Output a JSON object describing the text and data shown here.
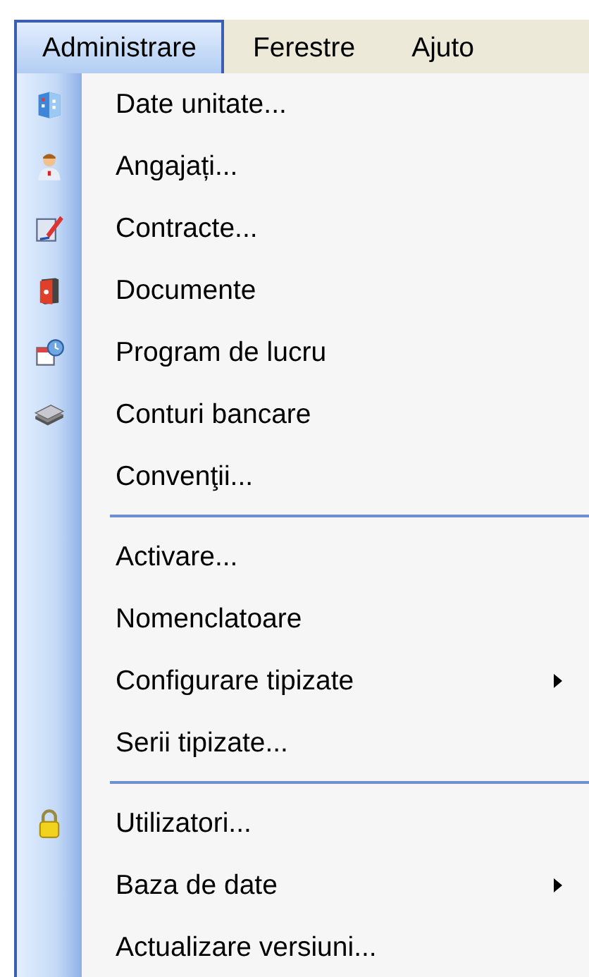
{
  "menubar": [
    {
      "label": "Administrare",
      "selected": true
    },
    {
      "label": "Ferestre",
      "selected": false
    },
    {
      "label": "Ajuto",
      "selected": false
    }
  ],
  "menu": [
    {
      "kind": "item",
      "label": "Date unitate...",
      "submenu": false
    },
    {
      "kind": "item",
      "label": "Angajați...",
      "submenu": false
    },
    {
      "kind": "item",
      "label": "Contracte...",
      "submenu": false
    },
    {
      "kind": "item",
      "label": "Documente",
      "submenu": false
    },
    {
      "kind": "item",
      "label": "Program de lucru",
      "submenu": false
    },
    {
      "kind": "item",
      "label": "Conturi bancare",
      "submenu": false
    },
    {
      "kind": "item",
      "label": "Convenţii...",
      "submenu": false
    },
    {
      "kind": "separator"
    },
    {
      "kind": "item",
      "label": "Activare...",
      "submenu": false
    },
    {
      "kind": "item",
      "label": "Nomenclatoare",
      "submenu": false
    },
    {
      "kind": "item",
      "label": "Configurare tipizate",
      "submenu": true
    },
    {
      "kind": "item",
      "label": "Serii tipizate...",
      "submenu": false
    },
    {
      "kind": "separator"
    },
    {
      "kind": "item",
      "label": "Utilizatori...",
      "submenu": false
    },
    {
      "kind": "item",
      "label": "Baza de date",
      "submenu": true
    },
    {
      "kind": "item",
      "label": "Actualizare versiuni...",
      "submenu": false
    }
  ]
}
